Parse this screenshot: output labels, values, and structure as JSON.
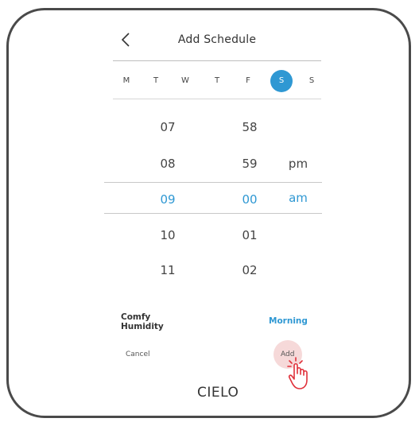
{
  "header": {
    "title": "Add Schedule",
    "back_icon": "chevron-left-icon"
  },
  "days": [
    {
      "label": "M",
      "selected": false
    },
    {
      "label": "T",
      "selected": false
    },
    {
      "label": "W",
      "selected": false
    },
    {
      "label": "T",
      "selected": false
    },
    {
      "label": "F",
      "selected": false
    },
    {
      "label": "S",
      "selected": true
    },
    {
      "label": "S",
      "selected": false
    }
  ],
  "picker": {
    "hours": [
      "07",
      "08",
      "09",
      "10",
      "11"
    ],
    "minutes": [
      "58",
      "59",
      "00",
      "01",
      "02"
    ],
    "periods": [
      "pm",
      "am"
    ],
    "selected": {
      "hour": "09",
      "minute": "00",
      "period": "am"
    }
  },
  "mode": {
    "label_line1": "Comfy",
    "label_line2": "Humidity",
    "value": "Morning"
  },
  "actions": {
    "cancel": "Cancel",
    "add": "Add"
  },
  "brand": {
    "logo": "CIELO"
  },
  "colors": {
    "accent": "#2f98d3",
    "frame": "#4a4a4a",
    "tap_highlight": "#f6d9d9",
    "cursor": "#e0303a"
  }
}
